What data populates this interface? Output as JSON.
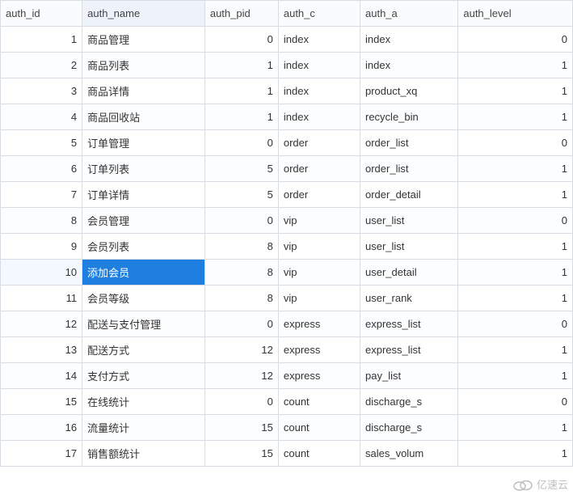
{
  "columns": {
    "auth_id": "auth_id",
    "auth_name": "auth_name",
    "auth_pid": "auth_pid",
    "auth_c": "auth_c",
    "auth_a": "auth_a",
    "auth_level": "auth_level"
  },
  "rows": [
    {
      "auth_id": "1",
      "auth_name": "商品管理",
      "auth_pid": "0",
      "auth_c": "index",
      "auth_a": "index",
      "auth_level": "0"
    },
    {
      "auth_id": "2",
      "auth_name": "商品列表",
      "auth_pid": "1",
      "auth_c": "index",
      "auth_a": "index",
      "auth_level": "1"
    },
    {
      "auth_id": "3",
      "auth_name": "商品详情",
      "auth_pid": "1",
      "auth_c": "index",
      "auth_a": "product_xq",
      "auth_level": "1"
    },
    {
      "auth_id": "4",
      "auth_name": "商品回收站",
      "auth_pid": "1",
      "auth_c": "index",
      "auth_a": "recycle_bin",
      "auth_level": "1"
    },
    {
      "auth_id": "5",
      "auth_name": "订单管理",
      "auth_pid": "0",
      "auth_c": "order",
      "auth_a": "order_list",
      "auth_level": "0"
    },
    {
      "auth_id": "6",
      "auth_name": "订单列表",
      "auth_pid": "5",
      "auth_c": "order",
      "auth_a": "order_list",
      "auth_level": "1"
    },
    {
      "auth_id": "7",
      "auth_name": "订单详情",
      "auth_pid": "5",
      "auth_c": "order",
      "auth_a": "order_detail",
      "auth_level": "1"
    },
    {
      "auth_id": "8",
      "auth_name": "会员管理",
      "auth_pid": "0",
      "auth_c": "vip",
      "auth_a": "user_list",
      "auth_level": "0"
    },
    {
      "auth_id": "9",
      "auth_name": "会员列表",
      "auth_pid": "8",
      "auth_c": "vip",
      "auth_a": "user_list",
      "auth_level": "1"
    },
    {
      "auth_id": "10",
      "auth_name": "添加会员",
      "auth_pid": "8",
      "auth_c": "vip",
      "auth_a": "user_detail",
      "auth_level": "1"
    },
    {
      "auth_id": "11",
      "auth_name": "会员等级",
      "auth_pid": "8",
      "auth_c": "vip",
      "auth_a": "user_rank",
      "auth_level": "1"
    },
    {
      "auth_id": "12",
      "auth_name": "配送与支付管理",
      "auth_pid": "0",
      "auth_c": "express",
      "auth_a": "express_list",
      "auth_level": "0"
    },
    {
      "auth_id": "13",
      "auth_name": "配送方式",
      "auth_pid": "12",
      "auth_c": "express",
      "auth_a": "express_list",
      "auth_level": "1"
    },
    {
      "auth_id": "14",
      "auth_name": "支付方式",
      "auth_pid": "12",
      "auth_c": "express",
      "auth_a": "pay_list",
      "auth_level": "1"
    },
    {
      "auth_id": "15",
      "auth_name": "在线统计",
      "auth_pid": "0",
      "auth_c": "count",
      "auth_a": "discharge_s",
      "auth_level": "0"
    },
    {
      "auth_id": "16",
      "auth_name": "流量统计",
      "auth_pid": "15",
      "auth_c": "count",
      "auth_a": "discharge_s",
      "auth_level": "1"
    },
    {
      "auth_id": "17",
      "auth_name": "销售额统计",
      "auth_pid": "15",
      "auth_c": "count",
      "auth_a": "sales_volum",
      "auth_level": "1"
    }
  ],
  "selected_row_index": 9,
  "watermark": {
    "text": "亿速云"
  }
}
